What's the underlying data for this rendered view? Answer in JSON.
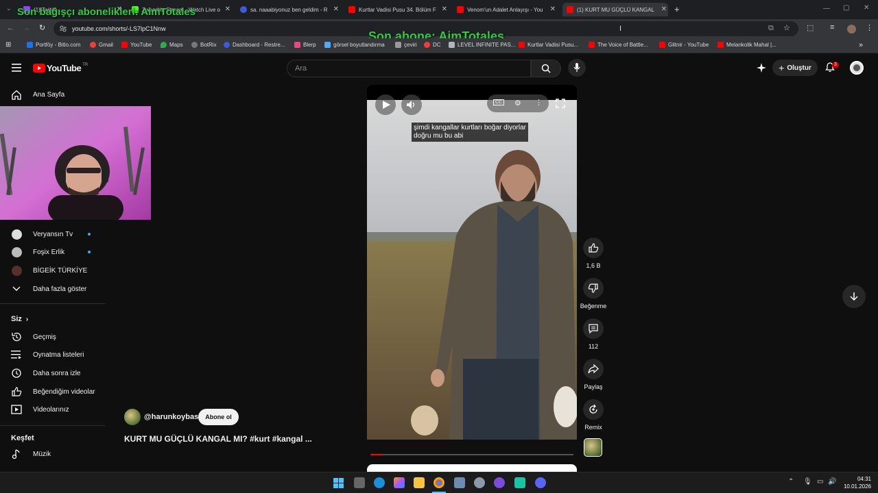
{
  "overlays": {
    "donors_text": "Son bağışçı abonelikleri: AimTotales",
    "last_sub_text": "Son abone: AimTotales"
  },
  "browser": {
    "tabs": [
      {
        "title": "(1) Twitch",
        "color": "#9146ff"
      },
      {
        "title": "Zwearbin Stream - Watch Live o",
        "color": "#53fc18"
      },
      {
        "title": "sa. naaabiyonuz ben geldim - R",
        "color": "#3b5bdb"
      },
      {
        "title": "Kurtlar Vadisi Pusu 34. Bölüm F",
        "color": "#ff0000"
      },
      {
        "title": "Venom'un Adalet Anlayışı - You",
        "color": "#ff0000"
      },
      {
        "title": "(1) KURT MU GÜÇLÜ KANGAL",
        "color": "#ff0000"
      }
    ],
    "new_tab": "+",
    "url": "youtube.com/shorts/-LS7lpC1Nnw",
    "bookmarks": [
      {
        "label": "Portföy - Bitlo.com",
        "color": "#1a73e8"
      },
      {
        "label": "Gmail",
        "color": "#ea4335"
      },
      {
        "label": "YouTube",
        "color": "#ff0000"
      },
      {
        "label": "Maps",
        "color": "#34a853"
      },
      {
        "label": "BotRix",
        "color": "#777"
      },
      {
        "label": "Dashboard - Restre...",
        "color": "#3b5bdb"
      },
      {
        "label": "Blerp",
        "color": "#e64980"
      },
      {
        "label": "görsel boyutlandırma",
        "color": "#4dabf7"
      },
      {
        "label": "çeviri",
        "color": "#999"
      },
      {
        "label": "DC",
        "color": "#f03e3e"
      },
      {
        "label": "LEVEL INFINITE PAS...",
        "color": "#adb5bd"
      },
      {
        "label": "Kurtlar Vadisi Pusu...",
        "color": "#ff0000"
      },
      {
        "label": "The Voice of Battle...",
        "color": "#ff0000"
      },
      {
        "label": "Glitnir - YouTube",
        "color": "#ff0000"
      },
      {
        "label": "Melankolik Mahal |...",
        "color": "#ff0000"
      }
    ]
  },
  "youtube": {
    "logo": "YouTube",
    "logo_sup": "TR",
    "search_placeholder": "Ara",
    "create_label": "Oluştur",
    "notif_count": "3",
    "sidebar": {
      "home": "Ana Sayfa",
      "subscriptions": [
        {
          "name": "Veryansın Tv",
          "dot": true
        },
        {
          "name": "Foşix Erlik",
          "dot": true
        },
        {
          "name": "BİGEİK TÜRKİYE",
          "dot": false
        }
      ],
      "show_more": "Daha fazla göster",
      "you_header": "Siz",
      "you_items": [
        "Geçmiş",
        "Oynatma listeleri",
        "Daha sonra izle",
        "Beğendiğim videolar",
        "Videolarınız"
      ],
      "explore_header": "Keşfet",
      "explore_items": [
        "Müzik"
      ]
    },
    "short": {
      "caption_line1": "şimdi kangallar kurtları boğar diyorlar",
      "caption_line2": "doğru mu bu abi",
      "channel": "@harunkoybasi",
      "subscribe": "Abone ol",
      "title": "KURT MU GÜÇLÜ KANGAL MI? #kurt #kangal ...",
      "progress": 0.06,
      "actions": {
        "likes": "1,6 B",
        "dislike": "Beğenme",
        "comments": "112",
        "share": "Paylaş",
        "remix": "Remix"
      }
    }
  },
  "taskbar": {
    "time": "04:31",
    "date": "10.01.2026"
  }
}
